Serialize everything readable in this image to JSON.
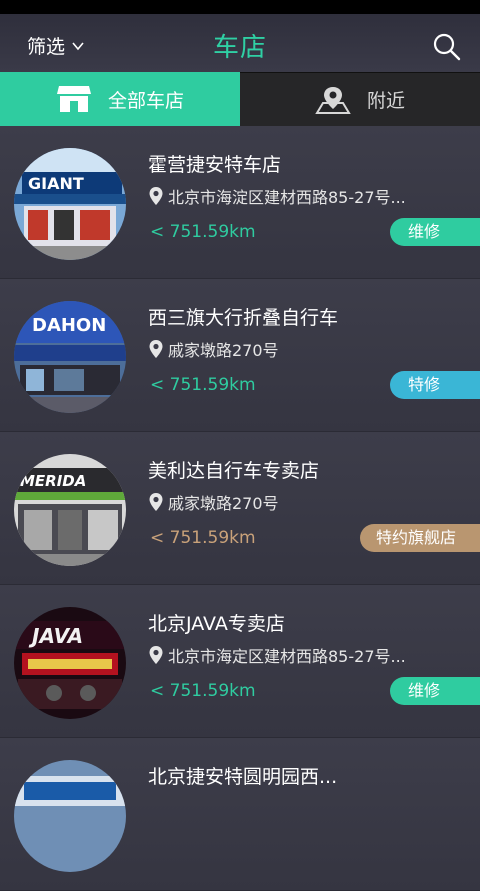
{
  "header": {
    "filter_label": "筛选",
    "title": "车店"
  },
  "tabs": [
    {
      "label": "全部车店",
      "active": true
    },
    {
      "label": "附近",
      "active": false
    }
  ],
  "colors": {
    "accent": "#2fcca0",
    "repair": "#2fcca0",
    "special": "#3ab6d6",
    "flagship": "#b99670"
  },
  "stores": [
    {
      "name": "霍营捷安特车店",
      "address": "北京市海淀区建材西路85-27号...",
      "distance": "< 751.59km",
      "badge": "维修",
      "sign": "GIANT"
    },
    {
      "name": "西三旗大行折叠自行车",
      "address": "戚家墩路270号",
      "distance": "< 751.59km",
      "badge": "特修",
      "sign": "DAHON"
    },
    {
      "name": "美利达自行车专卖店",
      "address": "戚家墩路270号",
      "distance": "< 751.59km",
      "badge": "特约旗舰店",
      "sign": "MERIDA"
    },
    {
      "name": "北京JAVA专卖店",
      "address": "北京市海定区建材西路85-27号...",
      "distance": "< 751.59km",
      "badge": "维修",
      "sign": "JAVA"
    },
    {
      "name": "北京捷安特圆明园西...",
      "address": "",
      "distance": "",
      "badge": "",
      "sign": ""
    }
  ]
}
